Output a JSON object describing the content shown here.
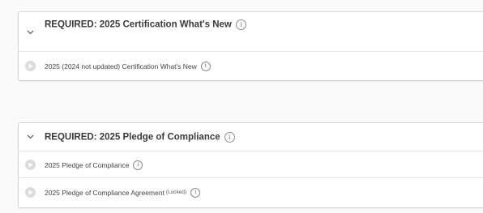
{
  "sections": [
    {
      "title": "REQUIRED: 2025 Certification What's New",
      "items": [
        {
          "label": "2025 (2024 not updated) Certification What's New",
          "tag": ""
        }
      ]
    },
    {
      "title": "REQUIRED: 2025 Pledge of Compliance",
      "items": [
        {
          "label": "2025 Pledge of Compliance",
          "tag": ""
        },
        {
          "label": "2025 Pledge of Compliance Agreement",
          "tag": "(Locked)"
        }
      ]
    }
  ],
  "icons": {
    "section_toggle": "chevron-down-icon",
    "info": "info-icon",
    "item_status": "play-circle-icon"
  },
  "info_glyph": "i",
  "colors": {
    "border": "#d6d6d6",
    "title_text": "#3a3a3a",
    "item_text": "#444444",
    "item_icon_bg": "#dcdcdc"
  }
}
